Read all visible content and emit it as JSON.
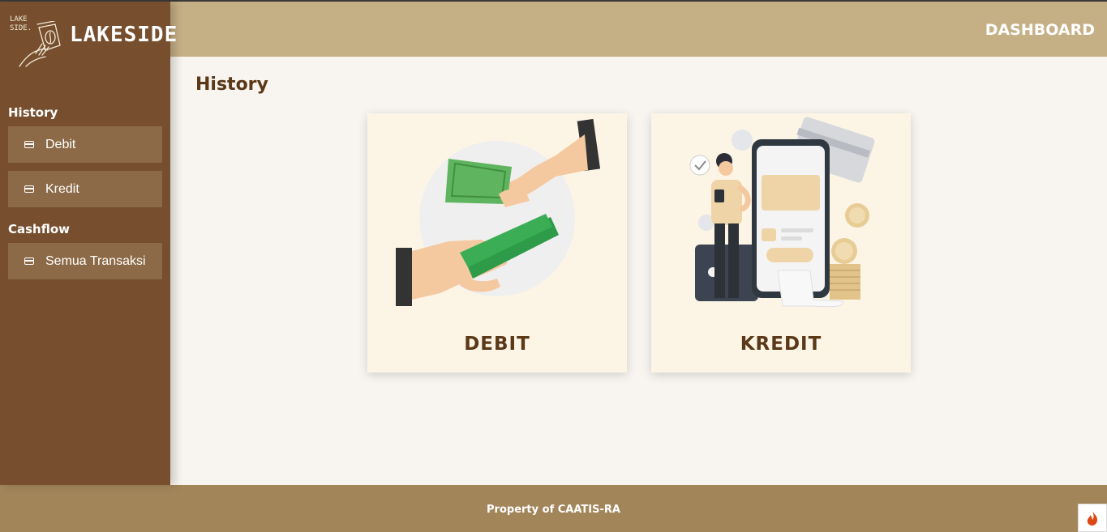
{
  "brand": {
    "small": "LAKE\nSIDE.",
    "name": "LAKESIDE"
  },
  "header": {
    "title": "DASHBOARD"
  },
  "sidebar": {
    "sections": [
      {
        "heading": "History",
        "items": [
          {
            "label": "Debit"
          },
          {
            "label": "Kredit"
          }
        ]
      },
      {
        "heading": "Cashflow",
        "items": [
          {
            "label": "Semua Transaksi"
          }
        ]
      }
    ]
  },
  "main": {
    "title": "History",
    "cards": [
      {
        "label": "DEBIT"
      },
      {
        "label": "KREDIT"
      }
    ]
  },
  "footer": {
    "text": "Property of CAATIS-RA"
  },
  "colors": {
    "sidebar": "#774f2e",
    "header": "#c5b086",
    "footer": "#a3855a",
    "nav_item": "#8d6a47",
    "card_bg": "#fcf5e6",
    "title_text": "#5a3818"
  },
  "icons": {
    "nav": "card-icon",
    "badge": "flame-icon"
  }
}
